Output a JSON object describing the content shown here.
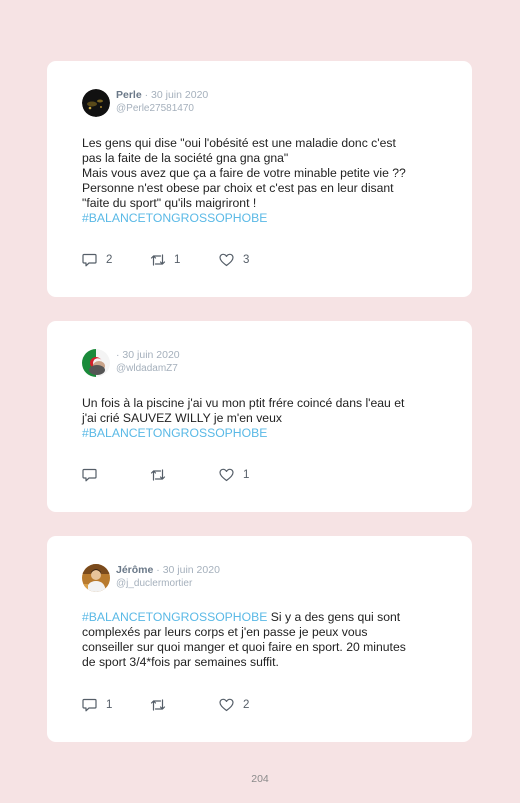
{
  "tweets": [
    {
      "name": "Perle",
      "separator": "·",
      "date": "30 juin 2020",
      "handle": "@Perle27581470",
      "lines": [
        "Les gens qui dise \"oui l'obésité est une maladie donc c'est",
        "pas la faite de la société gna gna gna\"",
        "Mais vous avez que ça a faire de votre minable petite vie ??",
        "Personne n'est obese par choix et c'est pas en leur disant",
        "\"faite du sport\" qu'ils maigriront !"
      ],
      "hashtag": "#BALANCETONGROSSOPHOBE",
      "replies": "2",
      "retweets": "1",
      "likes": "3",
      "avatar_icon": "dark-round-avatar"
    },
    {
      "name": "",
      "separator": "·",
      "date": "30 juin 2020",
      "handle": "@wldadamZ7",
      "lines": [
        "Un fois à la piscine j'ai vu mon ptit frére coincé dans l'eau et",
        "j'ai crié SAUVEZ WILLY je m'en veux"
      ],
      "hashtag": "#BALANCETONGROSSOPHOBE",
      "replies": "",
      "retweets": "",
      "likes": "1",
      "avatar_icon": "algerian-flag-avatar"
    },
    {
      "name": "Jérôme",
      "separator": "·",
      "date": "30 juin 2020",
      "handle": "@j_duclermortier",
      "hashtag": "#BALANCETONGROSSOPHOBE",
      "first_line_rest": "Si y a des gens qui sont",
      "lines": [
        "complexés par leurs corps et j'en passe je peux vous",
        "conseiller sur quoi manger et quoi faire en sport. 20 minutes",
        "de sport 3/4*fois par semaines suffit."
      ],
      "replies": "1",
      "retweets": "",
      "likes": "2",
      "avatar_icon": "person-photo-avatar"
    }
  ],
  "page_number": "204",
  "colors": {
    "background": "#f6e3e4",
    "card": "#ffffff",
    "hashtag": "#5ab9e6",
    "meta": "#a5b0bc"
  }
}
